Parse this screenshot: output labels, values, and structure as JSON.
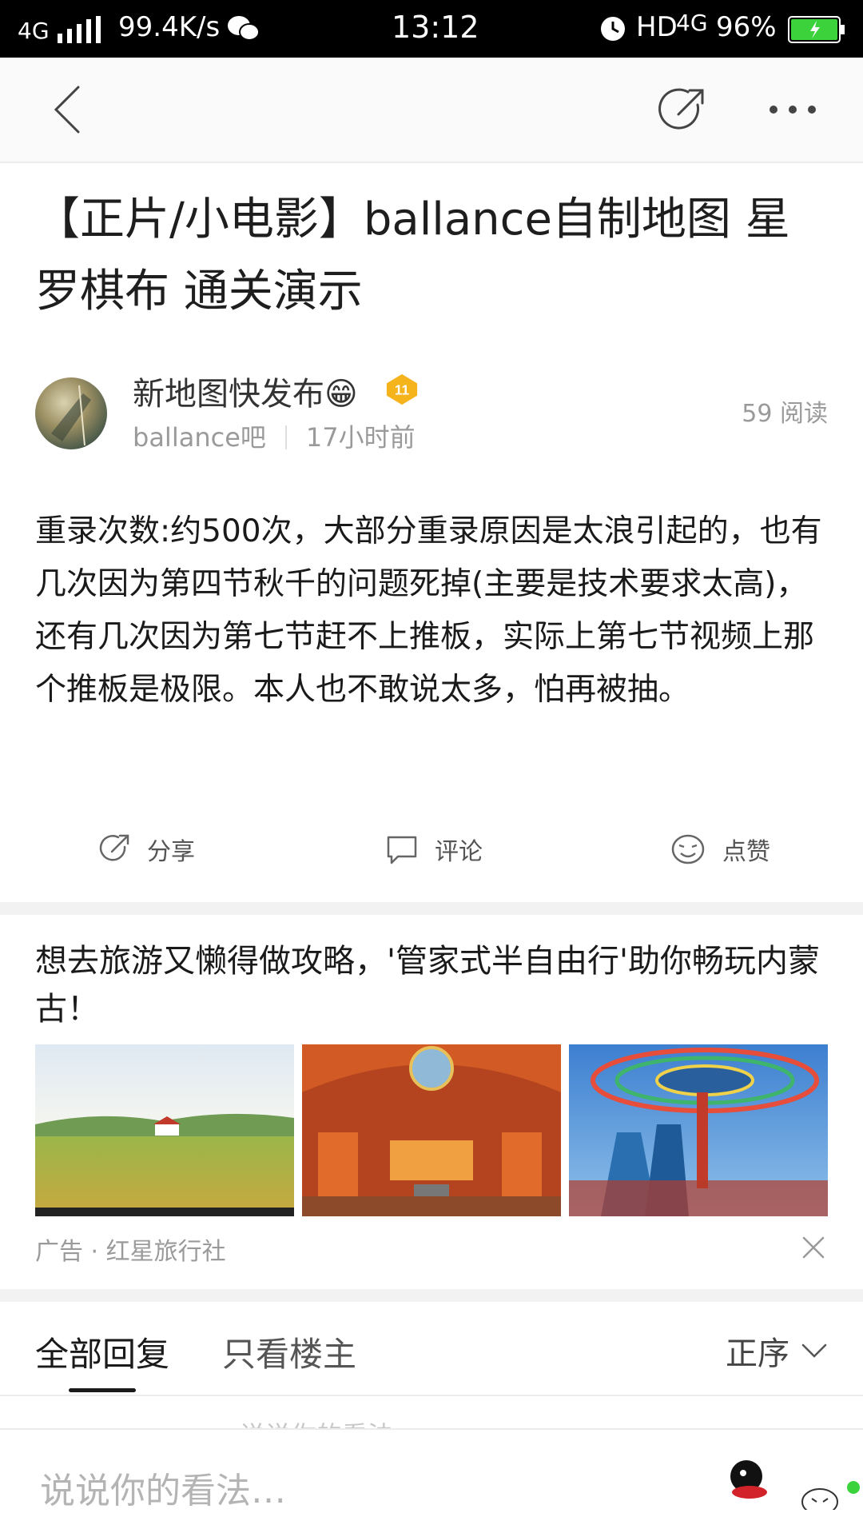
{
  "status_bar": {
    "network": "4G",
    "speed": "99.4K/s",
    "time": "13:12",
    "hd": "HD",
    "network2": "4G",
    "battery": "96%"
  },
  "post": {
    "title": "【正片/小电影】ballance自制地图 星罗棋布 通关演示",
    "author": "新地图快发布😁",
    "author_level": "11",
    "forum": "ballance吧",
    "time_ago": "17小时前",
    "reads": "59 阅读",
    "body": "重录次数:约500次，大部分重录原因是太浪引起的，也有几次因为第四节秋千的问题死掉(主要是技术要求太高)，还有几次因为第七节赶不上推板，实际上第七节视频上那个推板是极限。本人也不敢说太多，怕再被抽。"
  },
  "actions": {
    "share": "分享",
    "comment": "评论",
    "like": "点赞"
  },
  "ad": {
    "title": "想去旅游又懒得做攻略，'管家式半自由行'助你畅玩内蒙古！",
    "label": "广告 · 红星旅行社"
  },
  "replies": {
    "tab_all": "全部回复",
    "tab_op": "只看楼主",
    "sort": "正序",
    "peek_text": "说说你的看法..."
  },
  "comment_input": {
    "placeholder": "说说你的看法…"
  },
  "colors": {
    "accent_gold": "#f5b31c",
    "battery_green": "#3cd23c"
  }
}
